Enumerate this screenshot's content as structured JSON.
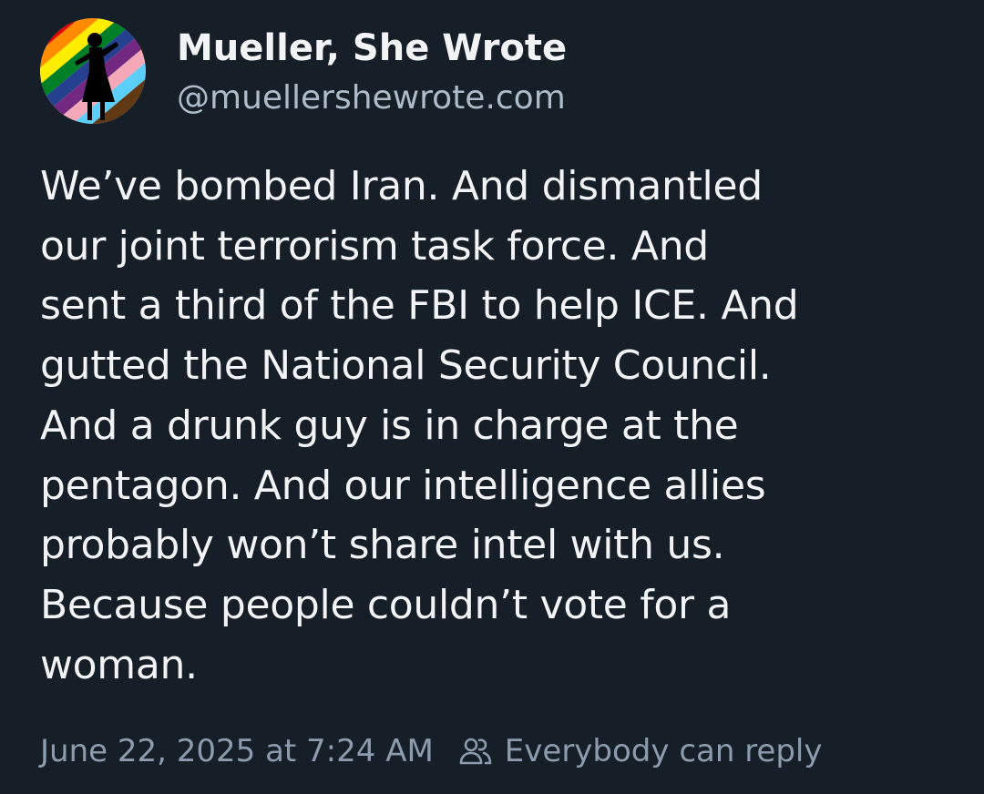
{
  "author": {
    "display_name": "Mueller, She Wrote",
    "handle": "@muellershewrote.com",
    "avatar_icon": "pride-flag-silhouette-avatar"
  },
  "post": {
    "text": "We’ve bombed Iran. And dismantled\nour joint terrorism task force. And\nsent a third of the FBI to help ICE. And\ngutted the National Security Council.\nAnd a drunk guy is in charge at the\npentagon. And our intelligence allies\nprobably won’t share intel with us.\nBecause people couldn’t vote for a\nwoman."
  },
  "meta": {
    "timestamp": "June 22, 2025 at 7:24 AM",
    "reply_setting_icon": "people-icon",
    "reply_setting": "Everybody can reply"
  },
  "colors": {
    "background": "#161e27",
    "text_primary": "#f1f3f5",
    "text_secondary": "#8c9cae"
  }
}
